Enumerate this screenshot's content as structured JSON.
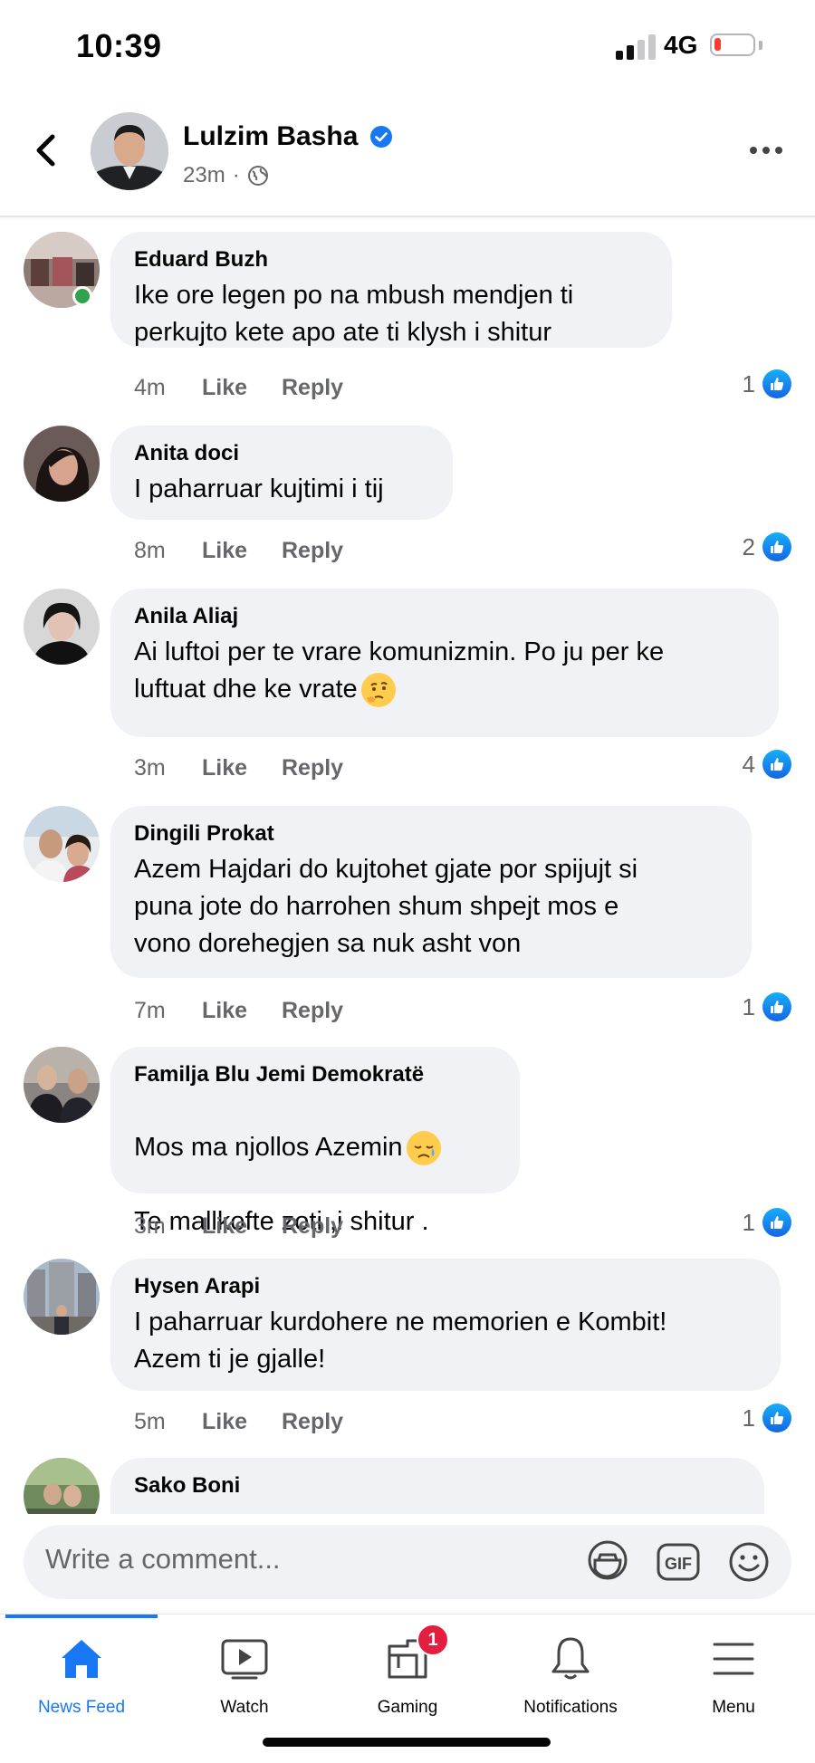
{
  "status": {
    "time": "10:39",
    "network": "4G"
  },
  "header": {
    "author": "Lulzim Basha",
    "time": "23m",
    "separator": "·"
  },
  "comments": [
    {
      "name": "Eduard Buzh",
      "text": "Ike ore legen po na mbush mendjen ti\nperkujto kete apo ate ti klysh i shitur",
      "time": "4m",
      "like": "Like",
      "reply": "Reply",
      "reactions": "1"
    },
    {
      "name": "Anita doci",
      "text": "I paharruar kujtimi i tij",
      "time": "8m",
      "like": "Like",
      "reply": "Reply",
      "reactions": "2"
    },
    {
      "name": "Anila Aliaj",
      "text": "Ai luftoi per te vrare komunizmin. Po ju per ke\nluftuat dhe ke vrate",
      "time": "3m",
      "like": "Like",
      "reply": "Reply",
      "reactions": "4",
      "emoji": "thinking-face"
    },
    {
      "name": "Dingili Prokat",
      "text": "Azem Hajdari do kujtohet gjate por spijujt si\npuna jote do harrohen shum shpejt mos e\nvono dorehegjen sa nuk asht von",
      "time": "7m",
      "like": "Like",
      "reply": "Reply",
      "reactions": "1"
    },
    {
      "name": "Familja Blu Jemi Demokratë",
      "text_line1": "Mos ma njollos Azemin",
      "text_line2": "Te mallkofte zoti ,i shitur .",
      "time": "3m",
      "like": "Like",
      "reply": "Reply",
      "reactions": "1",
      "emoji": "sad-face"
    },
    {
      "name": "Hysen Arapi",
      "text": "I paharruar kurdohere ne memorien e Kombit!\nAzem ti je gjalle!",
      "time": "5m",
      "like": "Like",
      "reply": "Reply",
      "reactions": "1"
    },
    {
      "name": "Sako Boni"
    }
  ],
  "composer": {
    "placeholder": "Write a comment...",
    "gif_label": "GIF"
  },
  "tabs": [
    {
      "label": "News Feed",
      "icon": "home-icon",
      "active": true
    },
    {
      "label": "Watch",
      "icon": "watch-icon"
    },
    {
      "label": "Gaming",
      "icon": "gaming-icon",
      "badge": "1"
    },
    {
      "label": "Notifications",
      "icon": "bell-icon"
    },
    {
      "label": "Menu",
      "icon": "menu-icon"
    }
  ],
  "colors": {
    "accent": "#1877f2",
    "badge": "#e41e3f",
    "bubble": "#f0f2f5"
  }
}
